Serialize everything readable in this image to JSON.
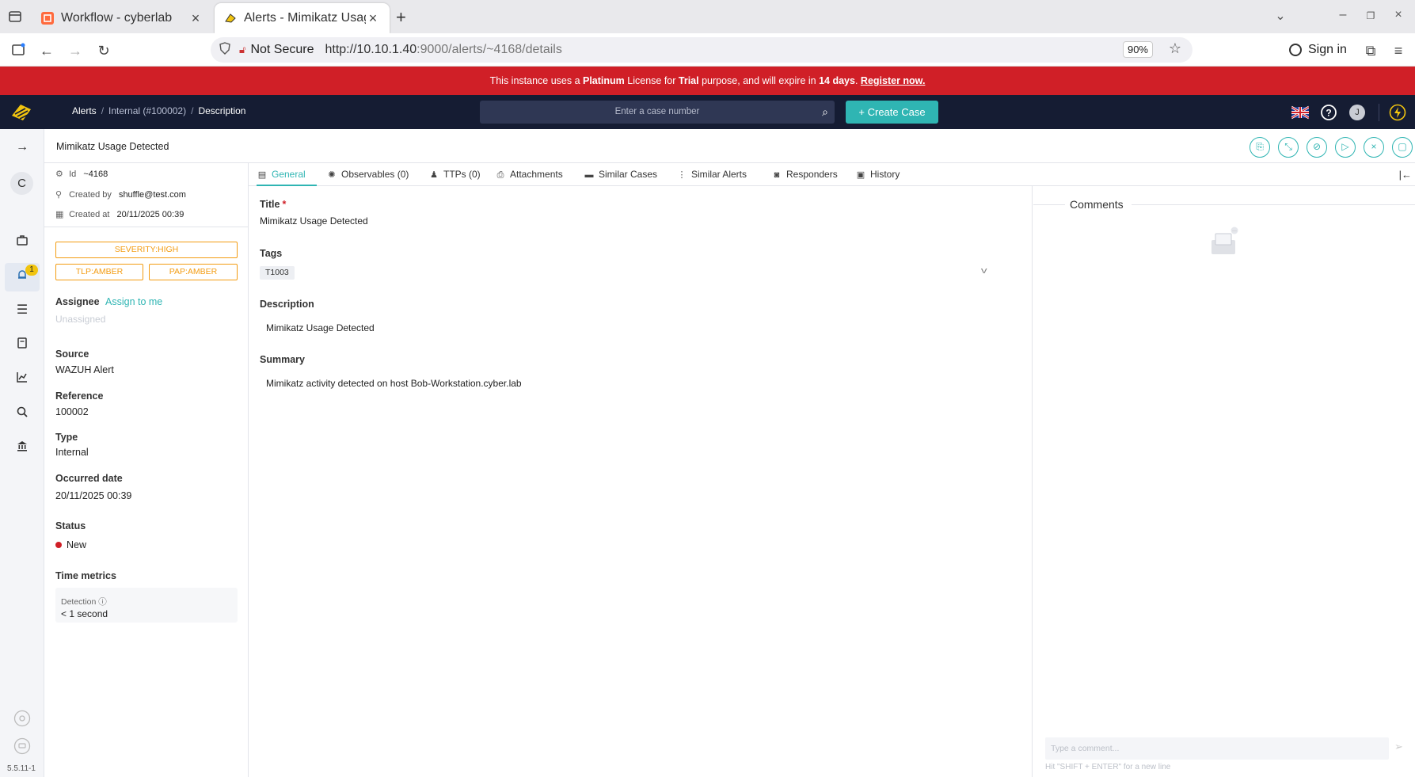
{
  "browser": {
    "tabs": [
      {
        "title": "Workflow - cyberlab",
        "active": false
      },
      {
        "title": "Alerts - Mimikatz Usage D",
        "active": true
      }
    ],
    "security_label": "Not Secure",
    "url_host": "http://10.10.1.40",
    "url_rest": ":9000/alerts/~4168/details",
    "zoom": "90%",
    "sign_in": "Sign in"
  },
  "banner": {
    "pre": "This instance uses a ",
    "license": "Platinum",
    "mid1": " License for ",
    "purpose": "Trial",
    "mid2": " purpose, and will expire in ",
    "days": "14 days",
    "mid3": ". ",
    "link": "Register now."
  },
  "topnav": {
    "crumb_root": "Alerts",
    "crumb_mid": "Internal (#100002)",
    "crumb_current": "Description",
    "search_placeholder": "Enter a case number",
    "create_button": "+ Create Case",
    "user_initial": "J"
  },
  "sidebar": {
    "org_initial": "C",
    "alerts_badge": "1",
    "version": "5.5.11-1"
  },
  "alert": {
    "title": "Mimikatz Usage Detected",
    "id_label": "Id",
    "id": "~4168",
    "created_by_label": "Created by",
    "created_by": "shuffle@test.com",
    "created_at_label": "Created at",
    "created_at": "20/11/2025 00:39",
    "severity_tag": "SEVERITY:HIGH",
    "tlp_tag": "TLP:AMBER",
    "pap_tag": "PAP:AMBER",
    "assignee_label": "Assignee",
    "assign_link": "Assign to me",
    "assignee_value": "Unassigned",
    "source_label": "Source",
    "source": "WAZUH Alert",
    "reference_label": "Reference",
    "reference": "100002",
    "type_label": "Type",
    "type": "Internal",
    "occurred_label": "Occurred date",
    "occurred": "20/11/2025 00:39",
    "status_label": "Status",
    "status": "New",
    "status_color": "#d01f27",
    "time_metrics_label": "Time metrics",
    "detection_label": "Detection",
    "detection_value": "< 1 second"
  },
  "tabs": [
    {
      "label": "General",
      "icon": "general-icon"
    },
    {
      "label": "Observables (0)",
      "icon": "observables-icon"
    },
    {
      "label": "TTPs (0)",
      "icon": "ttps-icon"
    },
    {
      "label": "Attachments",
      "icon": "attachment-icon"
    },
    {
      "label": "Similar Cases",
      "icon": "cases-icon"
    },
    {
      "label": "Similar Alerts",
      "icon": "alerts-icon"
    },
    {
      "label": "Responders",
      "icon": "responders-icon"
    },
    {
      "label": "History",
      "icon": "history-icon"
    }
  ],
  "general": {
    "title_label": "Title",
    "title_required": "*",
    "title_value": "Mimikatz Usage Detected",
    "tags_label": "Tags",
    "tag": "T1003",
    "description_label": "Description",
    "description": "Mimikatz Usage Detected",
    "summary_label": "Summary",
    "summary": "Mimikatz activity detected on host Bob-Workstation.cyber.lab"
  },
  "comments": {
    "title": "Comments",
    "placeholder": "Type a comment...",
    "hint": "Hit \"SHIFT + ENTER\" for a new line"
  },
  "colors": {
    "accent": "#2fb5b3",
    "banner": "#d01f27",
    "nav": "#151c33",
    "tag_amber": "#f39c12"
  }
}
